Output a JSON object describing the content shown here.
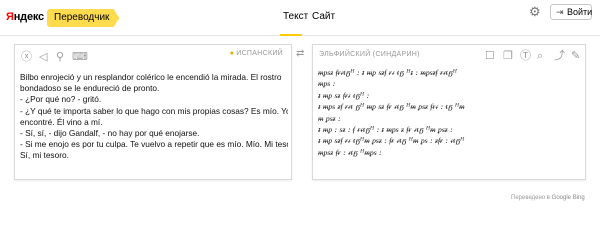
{
  "header": {
    "logo_first": "Я",
    "logo_rest": "ндекс",
    "service": "Переводчик",
    "tabs": [
      {
        "label": "Текст",
        "active": true
      },
      {
        "label": "Сайт",
        "active": false
      }
    ],
    "login_label": "Войти",
    "accent_color": "#ffcc00"
  },
  "source": {
    "language": "ИСПАНСКИЙ",
    "lines": [
      "Bilbo enrojeció y un resplandor colérico le encendió la mirada. El rostro",
      "bondadoso se le endureció de pronto.",
      "- ¿Por qué no? - gritó.",
      "- ¿Y qué te importa saber lo que hago con mis propias cosas? Es mío. Yo lo",
      "encontré. Él vino a mí.",
      "- Sí, sí, - dijo Gandalf, - no hay por qué enojarse.",
      "- Si me enojo es por tu culpa.  Te vuelvo a repetir que es mío. Mío. Mi tesoro.",
      "Sí, mi tesoro."
    ],
    "icons": [
      "close-icon",
      "audio-icon",
      "microphone-icon",
      "keyboard-icon"
    ]
  },
  "target": {
    "language": "ЭЛЬФИЙСКИЙ (СИНДАРИН)",
    "lines": [
      "ᵯᵱᵴᵶ ᵮᵲᵳᵵᵷᵸ : ᵻ ᵯᵱ ᵴᵶᵮ ᵲᵳ ᵵᵷ ᵸᵻ : ᵯᵱᵴᵶᵮ ᵲᵳᵵᵷᵸ",
      "ᵯᵱᵴ :",
      "ᵻ ᵯᵱ ᵴᵶ ᵮᵲᵳ ᵵᵷᵸ :",
      "ᵻ ᵯᵱᵴ ᵶᵮ ᵲᵳᵵ ᵷᵸ ᵯᵱ ᵴᵶ ᵮᵲ ᵳᵵᵷ ᵸᵯ ᵱᵴᵶ ᵮᵲᵳ : ᵵᵷ ᵸᵯ",
      "ᵯ ᵱᵴᵶ :",
      "ᵻ ᵯᵱ : ᵴᵶ : ᵮ ᵲᵳᵵᵷᵸ : ᵻ ᵯᵱᵴ ᵶ ᵮᵲ ᵳᵵᵷ ᵸᵯ ᵱᵴᵶ :",
      "ᵻ ᵯᵱ ᵴᵶᵮ ᵲᵳ ᵵᵷᵸᵯ ᵱᵴᵶ : ᵮᵲ ᵳᵵᵷ ᵸᵯ ᵱᵴ : ᵶᵮᵲ : ᵳᵵᵷᵸ",
      "ᵯᵱᵴᵶ ᵮᵲ : ᵳᵵᵷ ᵸᵯᵱᵴ :"
    ],
    "icons": [
      "bookmark-icon",
      "copy-icon",
      "font-icon",
      "search-icon",
      "share-icon",
      "edit-icon"
    ]
  },
  "footer": {
    "prefix": "Переведено в",
    "brand_1": "Google",
    "brand_2": "Bing"
  }
}
